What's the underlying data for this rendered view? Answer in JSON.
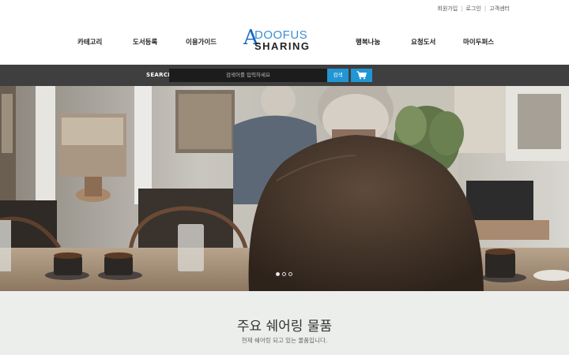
{
  "top_links": [
    "회원가입",
    "로그인",
    "고객센터"
  ],
  "nav": {
    "left": [
      "카테고리",
      "도서등록",
      "이용가이드"
    ],
    "right": [
      "행복나눔",
      "요청도서",
      "마이두퍼스"
    ]
  },
  "logo": {
    "letter": "A",
    "word1": "DOOFUS",
    "word2": "SHARING"
  },
  "search": {
    "label": "SEARCH",
    "placeholder": "검색어를 입력하세요",
    "button_label": "검색",
    "cart_icon": "cart-icon"
  },
  "hero": {
    "slides": 3,
    "active_slide": 1
  },
  "section": {
    "title": "주요 쉐어링 물품",
    "subtitle": "현재 쉐어링 되고 있는 물품입니다."
  },
  "colors": {
    "accent": "#2196d3",
    "search_bar": "#3f3f3f",
    "logo_blue": "#1565c0"
  }
}
